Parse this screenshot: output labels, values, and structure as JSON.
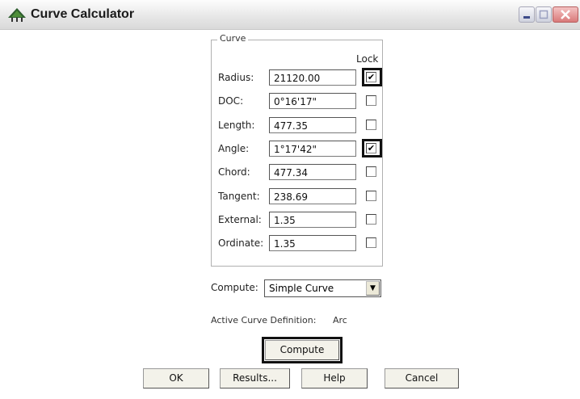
{
  "window": {
    "title": "Curve Calculator",
    "icon": "surveying-app-icon"
  },
  "curve_group": {
    "legend": "Curve",
    "lock_header": "Lock",
    "rows": [
      {
        "label": "Radius:",
        "value": "21120.00",
        "locked": true
      },
      {
        "label": "DOC:",
        "value": "0°16'17\"",
        "locked": false
      },
      {
        "label": "Length:",
        "value": "477.35",
        "locked": false
      },
      {
        "label": "Angle:",
        "value": "1°17'42\"",
        "locked": true
      },
      {
        "label": "Chord:",
        "value": "477.34",
        "locked": false
      },
      {
        "label": "Tangent:",
        "value": "238.69",
        "locked": false
      },
      {
        "label": "External:",
        "value": "1.35",
        "locked": false
      },
      {
        "label": "Ordinate:",
        "value": "1.35",
        "locked": false
      }
    ]
  },
  "compute": {
    "label": "Compute:",
    "selected": "Simple Curve",
    "active_definition_label": "Active Curve Definition:",
    "active_definition_value": "Arc",
    "button": "Compute"
  },
  "buttons": {
    "ok": "OK",
    "results": "Results...",
    "help": "Help",
    "cancel": "Cancel"
  }
}
